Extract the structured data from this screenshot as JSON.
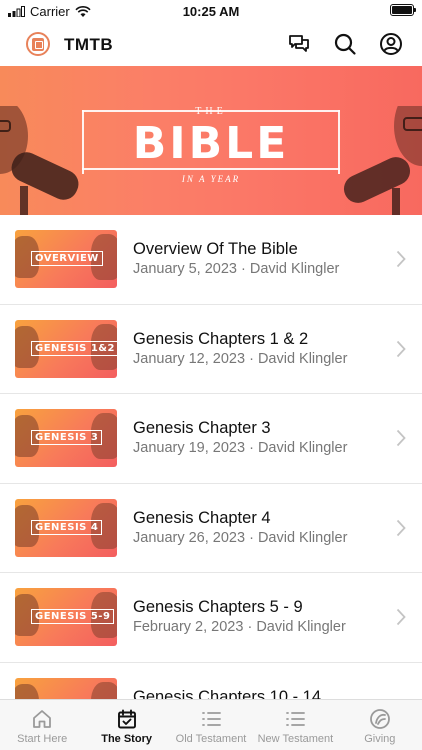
{
  "status_bar": {
    "carrier": "Carrier",
    "time": "10:25 AM"
  },
  "header": {
    "title": "TMTB",
    "icons": [
      "chat-icon",
      "search-icon",
      "profile-icon"
    ]
  },
  "banner": {
    "the": "THE",
    "title": "BIBLE",
    "subtitle": "IN A YEAR"
  },
  "episodes": [
    {
      "thumb_label": "OVERVIEW",
      "title": "Overview Of The Bible",
      "meta": "January 5, 2023 · David Klingler"
    },
    {
      "thumb_label": "GENESIS 1&2",
      "title": "Genesis Chapters 1 & 2",
      "meta": "January 12, 2023 · David Klingler"
    },
    {
      "thumb_label": "GENESIS 3",
      "title": "Genesis Chapter 3",
      "meta": "January 19, 2023 · David Klingler"
    },
    {
      "thumb_label": "GENESIS 4",
      "title": "Genesis Chapter 4",
      "meta": "January 26, 2023 · David Klingler"
    },
    {
      "thumb_label": "GENESIS 5-9",
      "title": "Genesis Chapters 5 - 9",
      "meta": "February 2, 2023 · David Klingler"
    },
    {
      "thumb_label": "",
      "title": "Genesis Chapters 10 - 14",
      "meta": ""
    }
  ],
  "tabs": [
    {
      "label": "Start Here",
      "icon": "home-icon"
    },
    {
      "label": "The Story",
      "icon": "calendar-icon",
      "active": true
    },
    {
      "label": "Old Testament",
      "icon": "list-icon"
    },
    {
      "label": "New Testament",
      "icon": "list-icon"
    },
    {
      "label": "Giving",
      "icon": "giving-icon"
    }
  ],
  "colors": {
    "accent": "#e8825a",
    "banner_start": "#f88a5a",
    "banner_end": "#f8695f"
  }
}
